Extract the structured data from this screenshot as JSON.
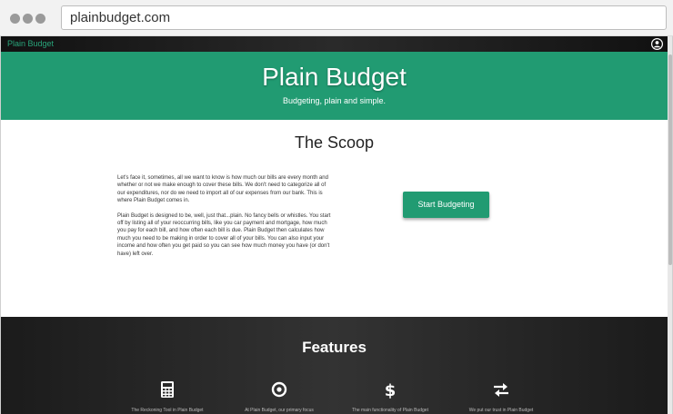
{
  "browser": {
    "url": "plainbudget.com"
  },
  "navbar": {
    "brand": "Plain Budget",
    "user_icon": "user-circle-icon"
  },
  "hero": {
    "title": "Plain Budget",
    "subtitle": "Budgeting, plain and simple."
  },
  "scoop": {
    "title": "The Scoop",
    "paragraphs": [
      "Let's face it, sometimes, all we want to know is how much our bills are every month and whether or not we make enough to cover these bills. We don't need to categorize all of our expenditures, nor do we need to import all of our expenses from our bank. This is where Plain Budget comes in.",
      "Plain Budget is designed to be, well, just that...plain. No fancy bells or whistles. You start off by listing all of your reoccurring bills, like you car payment and mortgage, how much you pay for each bill, and how often each bill is due. Plain Budget then calculates how much you need to be making in order to cover all of your bills. You can also input your income and how often you get paid so you can see how much money you have (or don't have) left over."
    ],
    "button_label": "Start Budgeting"
  },
  "features": {
    "title": "Features",
    "items": [
      {
        "icon": "calculator-icon",
        "caption": "The Reckoning Tool in Plain Budget"
      },
      {
        "icon": "target-icon",
        "caption": "At Plain Budget, our primary focus"
      },
      {
        "icon": "dollar-icon",
        "caption": "The main functionality of Plain Budget"
      },
      {
        "icon": "swap-arrows-icon",
        "caption": "We put our trust in Plain Budget"
      }
    ]
  },
  "colors": {
    "brand_green": "#219b72",
    "nav_dark": "#1b1b1b",
    "features_dark": "#2a2a2a"
  }
}
